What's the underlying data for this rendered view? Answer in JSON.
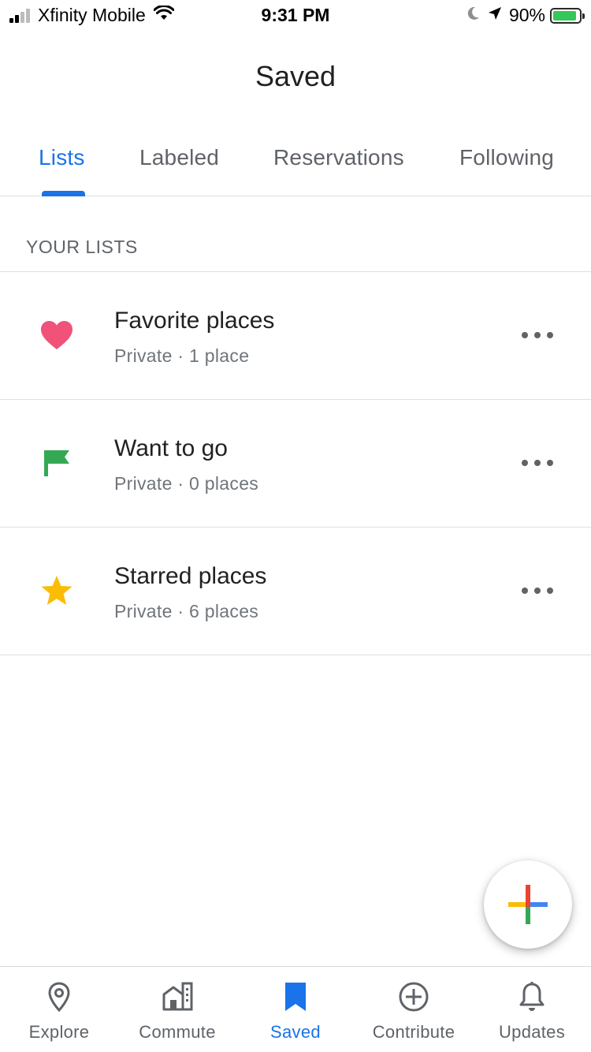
{
  "status_bar": {
    "carrier": "Xfinity Mobile",
    "time": "9:31 PM",
    "battery_percent": "90%",
    "battery_level": 0.9,
    "icons": [
      "signal-icon",
      "wifi-icon",
      "moon-icon",
      "location-arrow-icon",
      "battery-charging-icon"
    ]
  },
  "header": {
    "title": "Saved"
  },
  "tabs": [
    {
      "label": "Lists",
      "active": true
    },
    {
      "label": "Labeled",
      "active": false
    },
    {
      "label": "Reservations",
      "active": false
    },
    {
      "label": "Following",
      "active": false
    }
  ],
  "section": {
    "title": "YOUR LISTS"
  },
  "lists": [
    {
      "title": "Favorite places",
      "subtitle": "Private · 1 place",
      "icon": "heart-icon",
      "color": "#f0527a"
    },
    {
      "title": "Want to go",
      "subtitle": "Private · 0 places",
      "icon": "flag-icon",
      "color": "#34a853"
    },
    {
      "title": "Starred places",
      "subtitle": "Private · 6 places",
      "icon": "star-icon",
      "color": "#fbbc04"
    }
  ],
  "fab": {
    "icon": "plus-icon",
    "colors": [
      "#ea4335",
      "#4285f4",
      "#34a853",
      "#fbbc04"
    ]
  },
  "bottom_nav": [
    {
      "label": "Explore",
      "icon": "location-pin-icon",
      "active": false
    },
    {
      "label": "Commute",
      "icon": "commute-icon",
      "active": false
    },
    {
      "label": "Saved",
      "icon": "bookmark-icon",
      "active": true
    },
    {
      "label": "Contribute",
      "icon": "add-circle-icon",
      "active": false
    },
    {
      "label": "Updates",
      "icon": "bell-icon",
      "active": false
    }
  ],
  "colors": {
    "accent": "#1a73e8",
    "text": "#202124",
    "secondary_text": "#5f6368"
  }
}
